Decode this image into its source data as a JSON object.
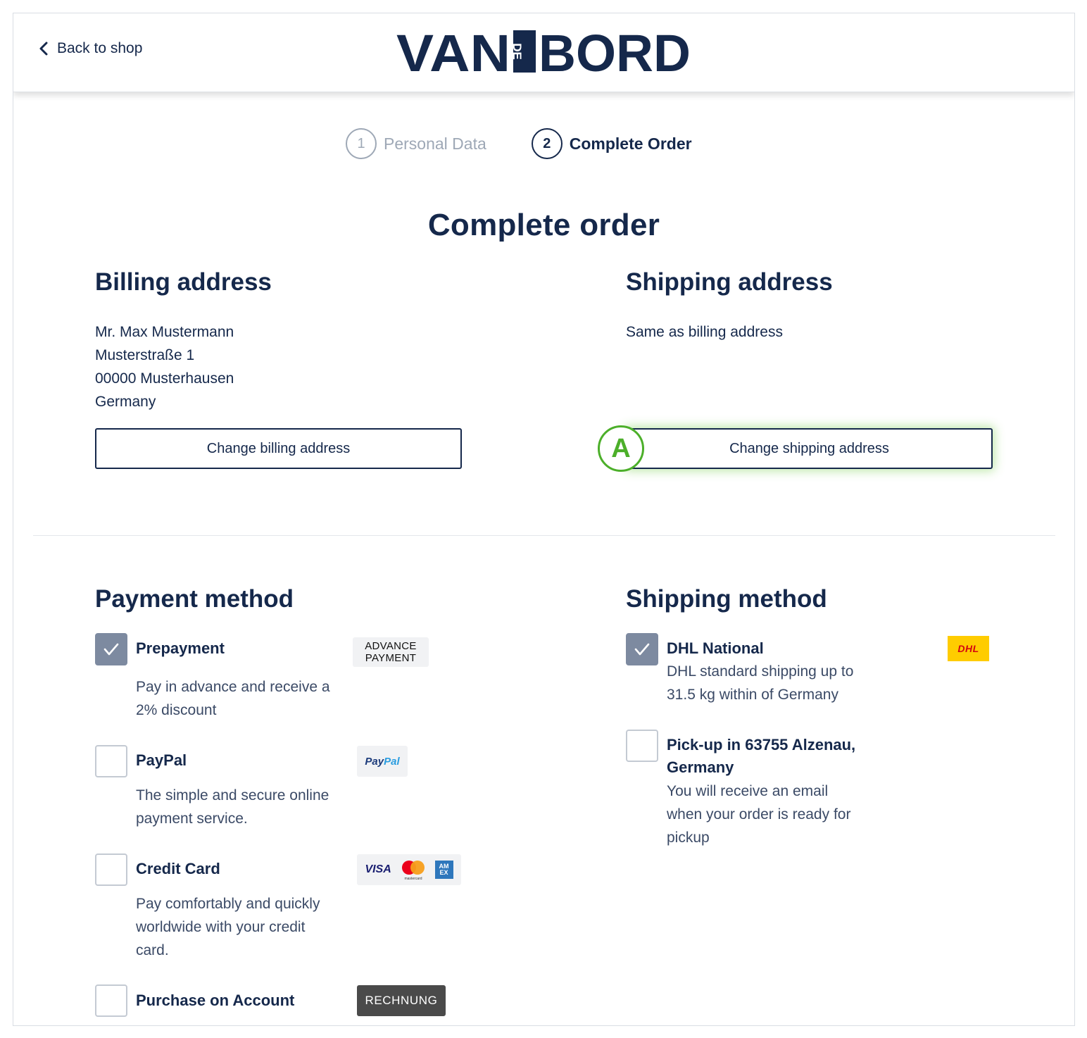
{
  "header": {
    "back_label": "Back to shop",
    "logo_text_left": "VAN",
    "logo_text_small": "DE",
    "logo_text_right": "BORD"
  },
  "stepper": {
    "steps": [
      {
        "number": "1",
        "label": "Personal Data",
        "active": false
      },
      {
        "number": "2",
        "label": "Complete Order",
        "active": true
      }
    ]
  },
  "page_title": "Complete order",
  "billing": {
    "heading": "Billing address",
    "lines": [
      "Mr. Max Mustermann",
      "Musterstraße 1",
      "00000 Musterhausen",
      "Germany"
    ],
    "button_label": "Change billing address"
  },
  "shipping_address": {
    "heading": "Shipping address",
    "text": "Same as billing address",
    "button_label": "Change shipping address",
    "marker": "A"
  },
  "payment": {
    "heading": "Payment method",
    "options": [
      {
        "title": "Prepayment",
        "desc_lines": [
          "Pay in advance and receive a",
          "2% discount"
        ],
        "checked": true,
        "badge_lines": [
          "ADVANCE",
          "PAYMENT"
        ]
      },
      {
        "title": "PayPal",
        "desc_lines": [
          "The simple and secure online",
          "payment service."
        ],
        "checked": false,
        "badge_part1": "Pay",
        "badge_part2": "Pal"
      },
      {
        "title": "Credit Card",
        "desc_lines": [
          "Pay comfortably and quickly",
          "worldwide with your credit",
          "card."
        ],
        "checked": false,
        "badge_visa": "VISA",
        "badge_mc": "mastercard",
        "badge_amex": "AM EX"
      },
      {
        "title": "Purchase on Account",
        "desc_lines": [],
        "checked": false,
        "badge": "RECHNUNG"
      }
    ]
  },
  "shipping_method": {
    "heading": "Shipping method",
    "options": [
      {
        "title_lines": [
          "DHL National"
        ],
        "desc_lines": [
          "DHL standard shipping up to",
          "31.5 kg within of Germany"
        ],
        "checked": true,
        "badge": "DHL"
      },
      {
        "title_lines": [
          "Pick-up in 63755 Alzenau,",
          "Germany"
        ],
        "desc_lines": [
          "You will receive an email",
          "when your order is ready for",
          "pickup"
        ],
        "checked": false
      }
    ]
  },
  "colors": {
    "brand_navy": "#15284b",
    "checkbox_checked": "#7d8aa0",
    "marker_green": "#4caf2a",
    "dhl_yellow": "#ffcc00",
    "dhl_red": "#d40511"
  },
  "icons": [
    "chevron-left-icon",
    "check-icon",
    "dhl-logo",
    "paypal-logo",
    "visa-logo",
    "mastercard-logo",
    "amex-logo"
  ]
}
